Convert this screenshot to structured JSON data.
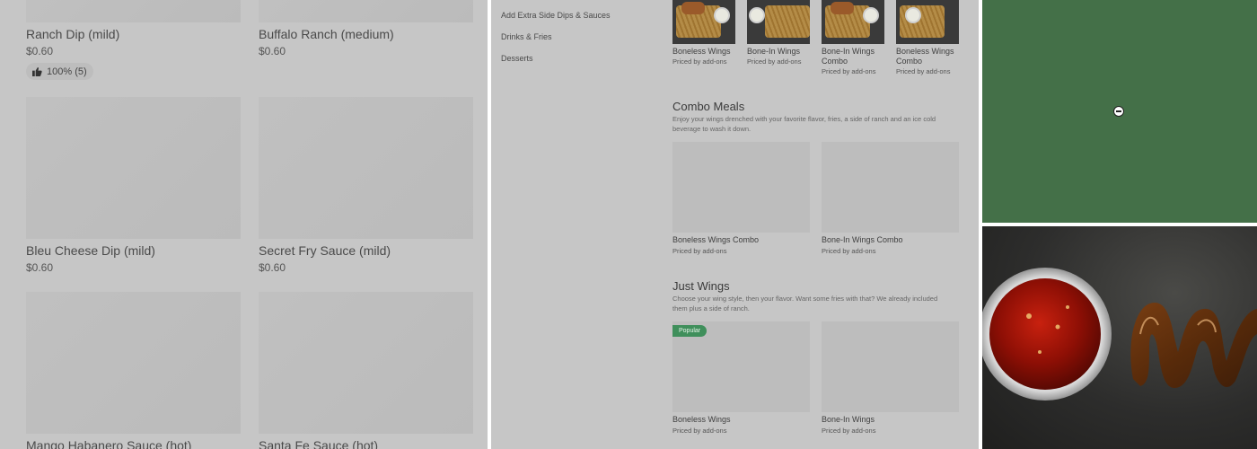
{
  "panel1": {
    "items": [
      {
        "name": "Ranch Dip (mild)",
        "price": "$0.60",
        "rating": "100% (5)"
      },
      {
        "name": "Buffalo Ranch (medium)",
        "price": "$0.60"
      },
      {
        "name": "Bleu Cheese Dip (mild)",
        "price": "$0.60"
      },
      {
        "name": "Secret Fry Sauce (mild)",
        "price": "$0.60"
      },
      {
        "name": "Mango Habanero Sauce (hot)"
      },
      {
        "name": "Santa Fe Sauce (hot)"
      }
    ]
  },
  "panel2": {
    "nav": [
      "Add Extra Side Dips & Sauces",
      "Drinks & Fries",
      "Desserts"
    ],
    "top_items": [
      {
        "name": "Boneless Wings",
        "sub": "Priced by add-ons"
      },
      {
        "name": "Bone-In Wings",
        "sub": "Priced by add-ons"
      },
      {
        "name": "Bone-In Wings Combo",
        "sub": "Priced by add-ons"
      },
      {
        "name": "Boneless Wings Combo",
        "sub": "Priced by add-ons"
      }
    ],
    "combo": {
      "title": "Combo Meals",
      "desc": "Enjoy your wings drenched with your favorite flavor, fries, a side of ranch and an ice cold beverage to wash it down.",
      "items": [
        {
          "name": "Boneless Wings Combo",
          "sub": "Priced by add-ons"
        },
        {
          "name": "Bone-In Wings Combo",
          "sub": "Priced by add-ons"
        }
      ]
    },
    "just_wings": {
      "title": "Just Wings",
      "desc": "Choose your wing style, then your flavor. Want some fries with that? We already included them plus a side of ranch.",
      "badge": "Popular",
      "items": [
        {
          "name": "Boneless Wings",
          "sub": "Priced by add-ons"
        },
        {
          "name": "Bone-In Wings",
          "sub": "Priced by add-ons"
        }
      ]
    }
  },
  "colors": {
    "panel_bg": "#c6c6c6",
    "green": "#447048",
    "badge": "#3f8f5b"
  },
  "icons": [
    "thumbs-up-icon",
    "minus-circle-icon"
  ]
}
